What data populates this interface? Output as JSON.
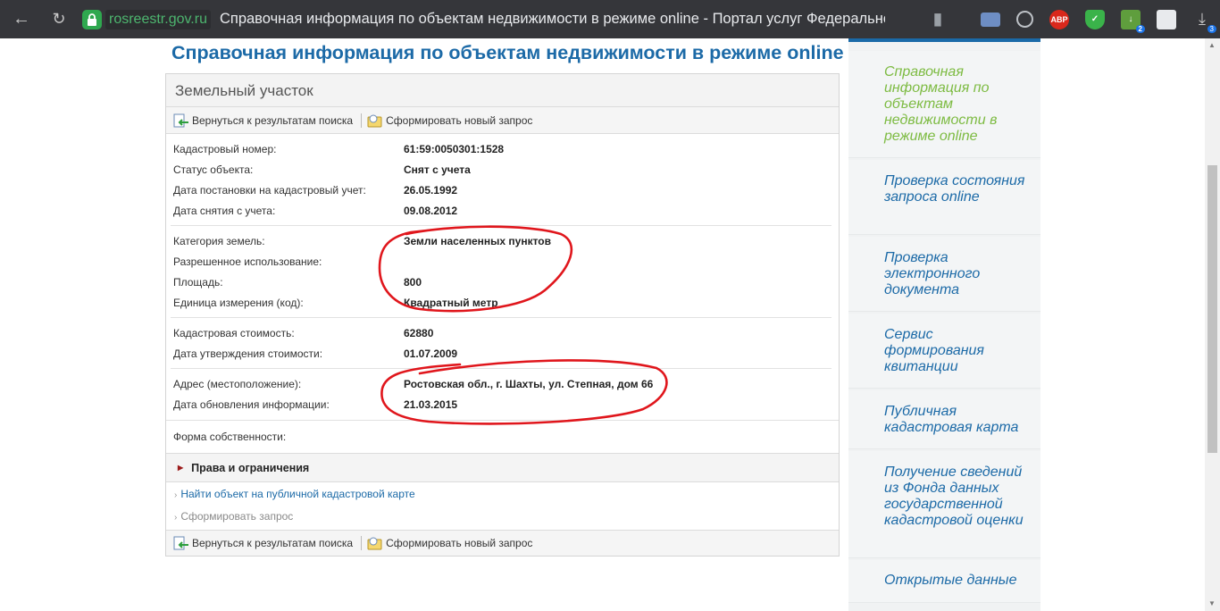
{
  "browser": {
    "domain": "rosreestr.gov.ru",
    "tab_title": "Справочная информация по объектам недвижимости в режиме online - Портал услуг Федерально...",
    "extensions": [
      {
        "name": "abp",
        "label": "ABP"
      },
      {
        "name": "download-badge",
        "label": "3"
      }
    ],
    "ext_badge": "2"
  },
  "page": {
    "heading": "Справочная информация по объектам недвижимости в режиме online",
    "panel_title": "Земельный участок",
    "toolbar": {
      "back_label": "Вернуться к результатам поиска",
      "new_request_label": "Сформировать новый запрос"
    },
    "fields": [
      {
        "label": "Кадастровый номер:",
        "value": "61:59:0050301:1528"
      },
      {
        "label": "Статус объекта:",
        "value": "Снят с учета"
      },
      {
        "label": "Дата постановки на кадастровый учет:",
        "value": "26.05.1992"
      },
      {
        "label": "Дата снятия с учета:",
        "value": "09.08.2012"
      },
      {
        "label": "Категория земель:",
        "value": "Земли населенных пунктов"
      },
      {
        "label": "Разрешенное использование:",
        "value": ""
      },
      {
        "label": "Площадь:",
        "value": "800"
      },
      {
        "label": "Единица измерения (код):",
        "value": "Квадратный метр"
      },
      {
        "label": "Кадастровая стоимость:",
        "value": "62880"
      },
      {
        "label": "Дата утверждения стоимости:",
        "value": "01.07.2009"
      },
      {
        "label": "Адрес (местоположение):",
        "value": "Ростовская обл., г. Шахты, ул. Степная, дом 66"
      },
      {
        "label": "Дата обновления информации:",
        "value": "21.03.2015"
      },
      {
        "label": "Форма собственности:",
        "value": ""
      }
    ],
    "rights_section": "Права и ограничения",
    "links": {
      "map_link": "Найти объект на публичной кадастровой карте",
      "request_link": "Сформировать запрос"
    }
  },
  "sidebar": {
    "items": [
      {
        "label": "Справочная информация по объектам недвижимости в режиме online",
        "current": true
      },
      {
        "label": "Проверка состояния запроса online"
      },
      {
        "label": "Проверка электронного документа"
      },
      {
        "label": "Сервис формирования квитанции"
      },
      {
        "label": "Публичная кадастровая карта"
      },
      {
        "label": "Получение сведений из Фонда данных государственной кадастровой оценки"
      },
      {
        "label": "Открытые данные"
      }
    ]
  },
  "colors": {
    "link_blue": "#1c6aa7",
    "current_green": "#7dbb42",
    "annotation_red": "#e0161c",
    "chrome_bg": "#35363a"
  }
}
